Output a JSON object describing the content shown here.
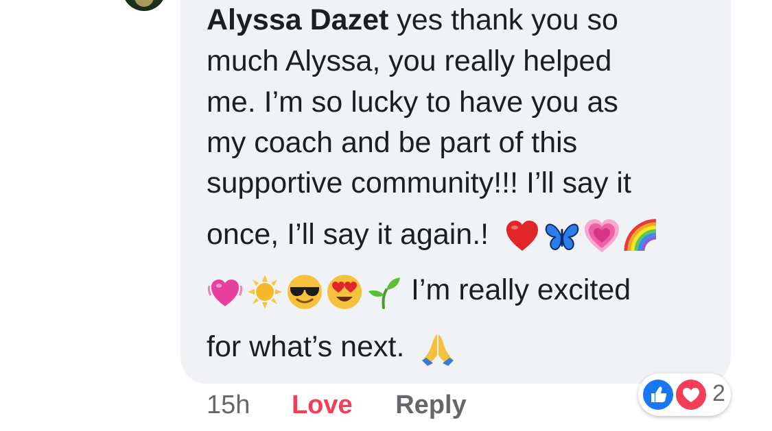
{
  "comment": {
    "author": "Alyssa Dazet",
    "lines": [
      " yes thank you so",
      "much Alyssa, you really helped",
      "me. I’m so lucky to have you as",
      "my coach and be part of this",
      "supportive community!!! I’ll say it",
      "once, I’ll say it again.!"
    ],
    "line7_text": " I’m really excited",
    "line8_text": "for what’s next.",
    "emojis_line6": [
      "red-heart",
      "blue-butterfly",
      "growing-heart",
      "rainbow"
    ],
    "emojis_line7": [
      "beating-heart",
      "sun",
      "smiling-face-with-sunglasses",
      "heart-eyes-face",
      "seedling"
    ],
    "emojis_line8": [
      "folded-hands"
    ]
  },
  "actions": {
    "time": "15h",
    "love_label": "Love",
    "reply_label": "Reply"
  },
  "reactions": {
    "count": "2",
    "types": [
      "like",
      "love"
    ]
  },
  "colors": {
    "bubble_bg": "#f0f2f5",
    "love": "#f33e58",
    "like": "#1877f2",
    "muted": "#65676b"
  }
}
